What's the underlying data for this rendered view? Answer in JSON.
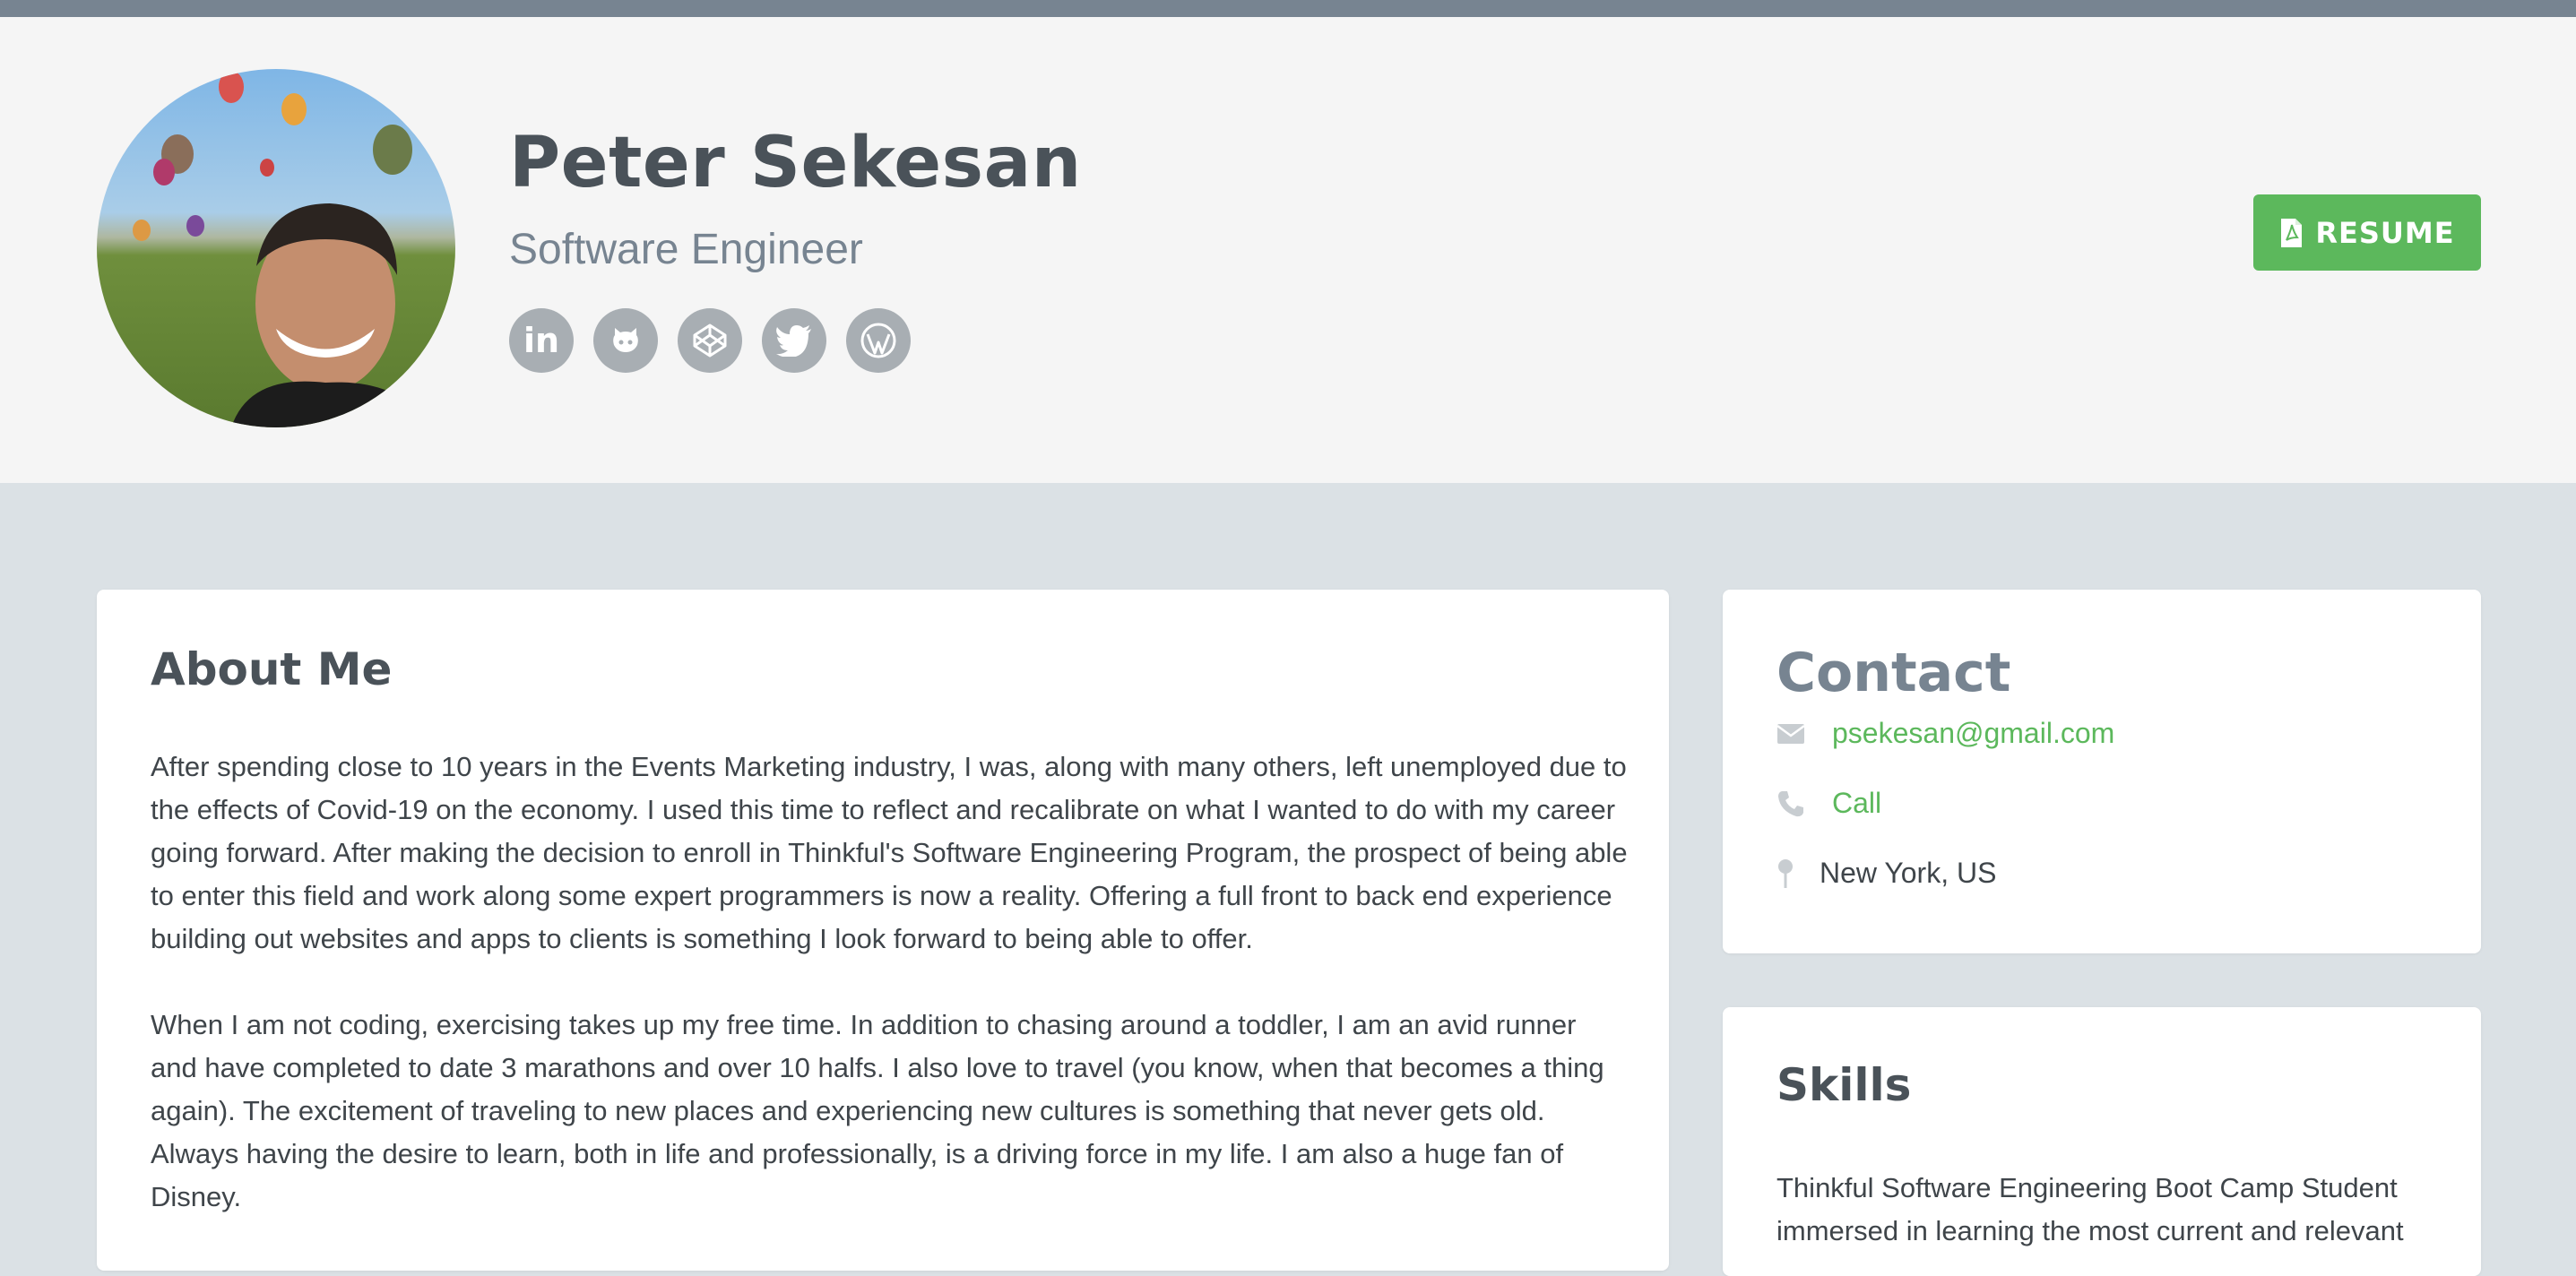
{
  "profile": {
    "name": "Peter Sekesan",
    "title": "Software Engineer"
  },
  "social": [
    {
      "icon": "linkedin-icon",
      "glyph": "in"
    },
    {
      "icon": "github-icon"
    },
    {
      "icon": "codepen-icon"
    },
    {
      "icon": "twitter-icon"
    },
    {
      "icon": "wordpress-icon"
    }
  ],
  "resume": {
    "label": "RESUME",
    "icon": "file-pdf-icon"
  },
  "about": {
    "heading": "About Me",
    "paragraphs": [
      "After spending close to 10 years in the Events Marketing industry, I was, along with many others, left unemployed due to the effects of Covid-19 on the economy. I used this time to reflect and recalibrate on what I wanted to do with my career going forward. After making the decision to enroll in Thinkful's Software Engineering Program, the prospect of being able to enter this field and work along some expert programmers is now a reality. Offering a full front to back end experience building out websites and apps to clients is something I look forward to being able to offer.",
      "When I am not coding, exercising takes up my free time. In addition to chasing around a toddler, I am an avid runner and have completed to date 3 marathons and over 10 halfs. I also love to travel (you know, when that becomes a thing again). The excitement of traveling to new places and experiencing new cultures is something that never gets old. Always having the desire to learn, both in life and professionally, is a driving force in my life. I am also a huge fan of Disney."
    ]
  },
  "contact": {
    "heading": "Contact",
    "email": "psekesan@gmail.com",
    "call": "Call",
    "location": "New York, US"
  },
  "skills": {
    "heading": "Skills",
    "text": "Thinkful Software Engineering Boot Camp Student immersed in learning the most current and relevant"
  },
  "colors": {
    "accent": "#5cb85c",
    "heading": "#4a5259",
    "muted": "#778491",
    "page_bg": "#dbe1e5",
    "header_bg": "#f5f5f5"
  }
}
